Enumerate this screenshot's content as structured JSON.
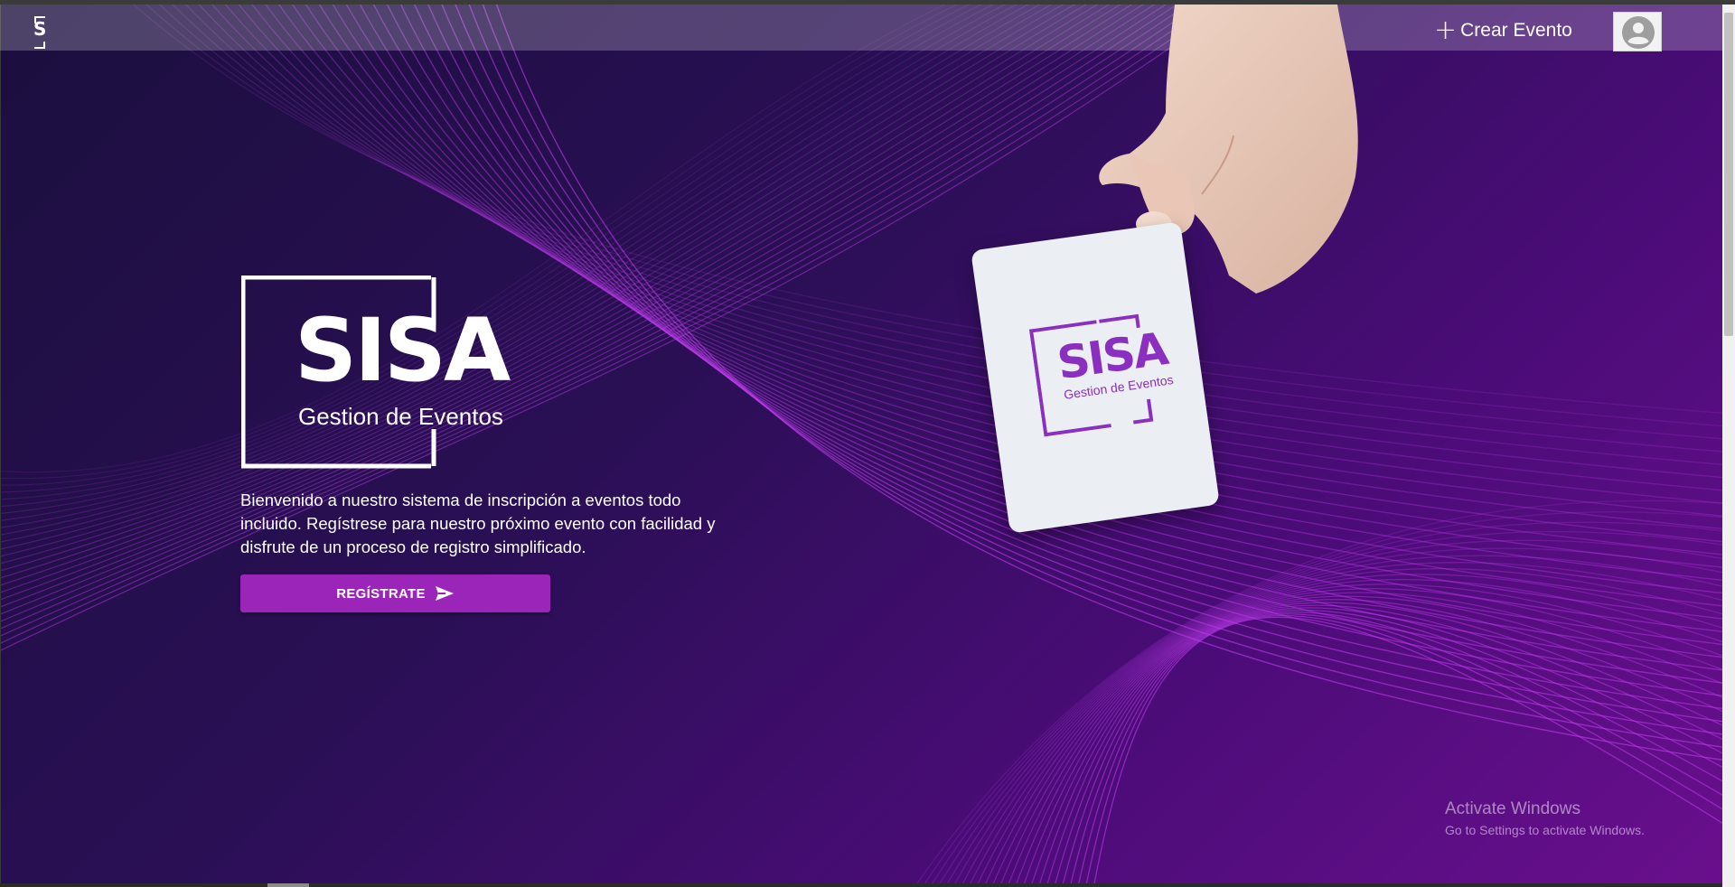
{
  "navbar": {
    "logo_letter": "S",
    "create_event_label": "Crear Evento",
    "create_event_icon": "plus-icon",
    "avatar_icon": "user-avatar-icon"
  },
  "hero": {
    "logo_title": "SISA",
    "logo_subtitle": "Gestion de Eventos",
    "intro_text": "Bienvenido a nuestro sistema de inscripción a eventos todo incluido. Regístrese para nuestro próximo evento con facilidad y disfrute de un proceso de registro simplificado.",
    "register_button_label": "REGÍSTRATE",
    "register_button_icon": "send-icon"
  },
  "card": {
    "title": "SISA",
    "subtitle": "Gestion de Eventos"
  },
  "watermark": {
    "title": "Activate Windows",
    "subtitle": "Go to Settings to activate Windows."
  },
  "colors": {
    "background_dark": "#1b0f3e",
    "background_purple": "#6a0f8e",
    "accent_button": "#9a25b8",
    "wave_lines": "#c23df0",
    "card_brand": "#8a2fc0"
  }
}
